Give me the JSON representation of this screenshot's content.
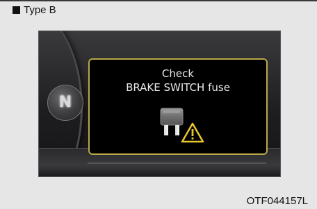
{
  "header": {
    "label": "Type B",
    "bullet_icon": "square-bullet-icon"
  },
  "cluster": {
    "gear_indicator": "N",
    "message": {
      "line1": "Check",
      "line2": "BRAKE SWITCH fuse"
    },
    "icons": [
      "fuse-icon",
      "warning-triangle-icon"
    ],
    "panel_border_color": "#b9a94a"
  },
  "figure_code": "OTF044157L"
}
